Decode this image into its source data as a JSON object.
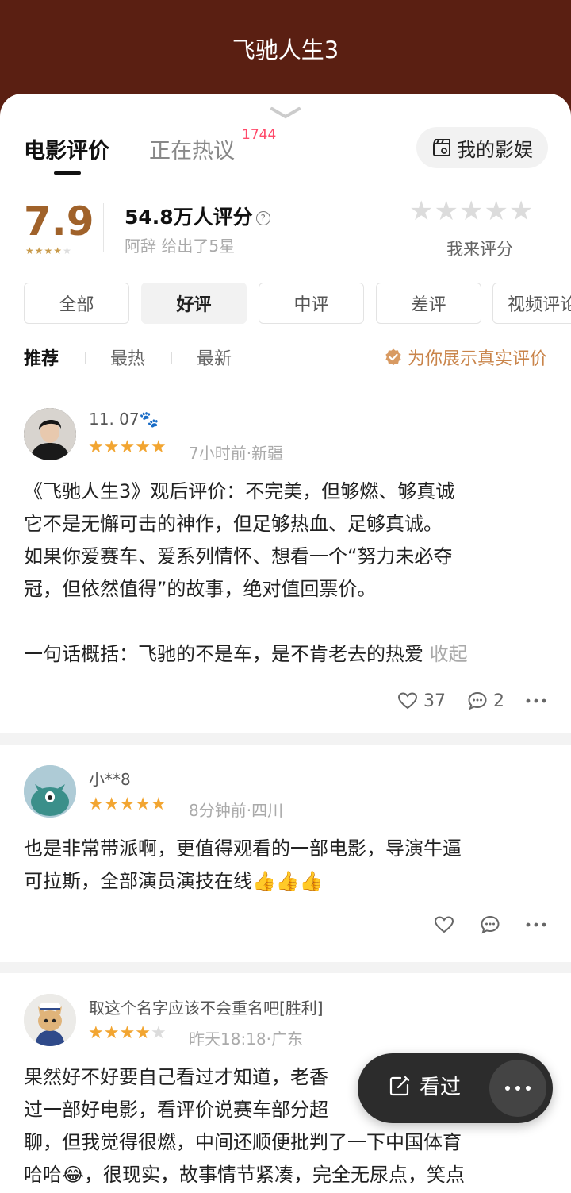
{
  "header": {
    "title": "飞驰人生3"
  },
  "tabs": {
    "reviews": "电影评价",
    "hot": "正在热议",
    "hot_badge": "1744"
  },
  "my_button": {
    "label": "我的影娱"
  },
  "rating": {
    "score": "7.9",
    "mini_stars_filled": 4,
    "count_text": "54.8万人评分",
    "friend_text": "阿辞 给出了5星",
    "rate_me": "我来评分"
  },
  "filters": [
    "全部",
    "好评",
    "中评",
    "差评",
    "视频评论"
  ],
  "sorts": {
    "recommend": "推荐",
    "hot": "最热",
    "new": "最新",
    "real_badge": "为你展示真实评价"
  },
  "reviews": [
    {
      "user": "11. 07🐾",
      "stars": 5,
      "meta": "7小时前·新疆",
      "lines": [
        "《飞驰人生3》观后评价：不完美，但够燃、够真诚",
        "它不是无懈可击的神作，但足够热血、足够真诚。",
        "如果你爱赛车、爱系列情怀、想看一个“努力未必夺",
        "冠，但依然值得”的故事，绝对值回票价。",
        "",
        "一句话概括：飞驰的不是车，是不肯老去的热爱"
      ],
      "collapse": "收起",
      "likes": "37",
      "comments": "2"
    },
    {
      "user": "小**8",
      "stars": 5,
      "meta": "8分钟前·四川",
      "lines": [
        "也是非常带派啊，更值得观看的一部电影，导演牛逼",
        "可拉斯，全部演员演技在线👍👍👍"
      ]
    },
    {
      "user": "取这个名字应该不会重名吧[胜利]",
      "stars": 4,
      "meta": "昨天18:18·广东",
      "lines": [
        "果然好不好要自己看过才知道，老香",
        "过一部好电影，看评价说赛车部分超",
        "聊，但我觉得很燃，中间还顺便批判了一下中国体育",
        "哈哈😂，很现实，故事情节紧凑，完全无尿点，笑点"
      ]
    }
  ],
  "float_bar": {
    "seen_label": "看过"
  }
}
